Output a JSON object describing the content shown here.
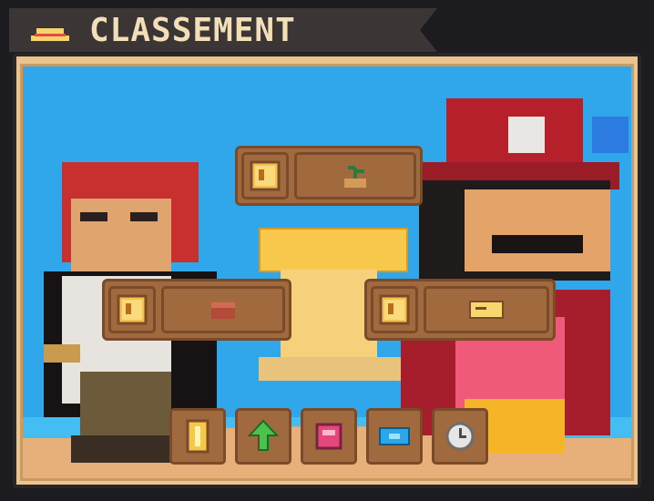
{
  "title": {
    "text": "CLASSEMENT",
    "icon": "straw-hat-icon"
  },
  "top_group": {
    "left_icon": "chart-frame-icon",
    "right_icon": "sprout-pot-icon"
  },
  "left_group": {
    "left_icon": "chart-frame-icon",
    "right_icon": "chest-icon"
  },
  "right_group": {
    "left_icon": "chart-frame-icon",
    "right_icon": "ticket-icon"
  },
  "bottom_toolbar": [
    {
      "icon": "gold-coin-icon"
    },
    {
      "icon": "green-arrow-up-icon"
    },
    {
      "icon": "pink-backpack-icon"
    },
    {
      "icon": "blue-ticket-icon"
    },
    {
      "icon": "clock-icon"
    }
  ],
  "colors": {
    "sky": "#30a7ea",
    "sand": "#e7b07a",
    "title_text": "#f3dfb7",
    "slot_brown": "#a06a3e"
  }
}
